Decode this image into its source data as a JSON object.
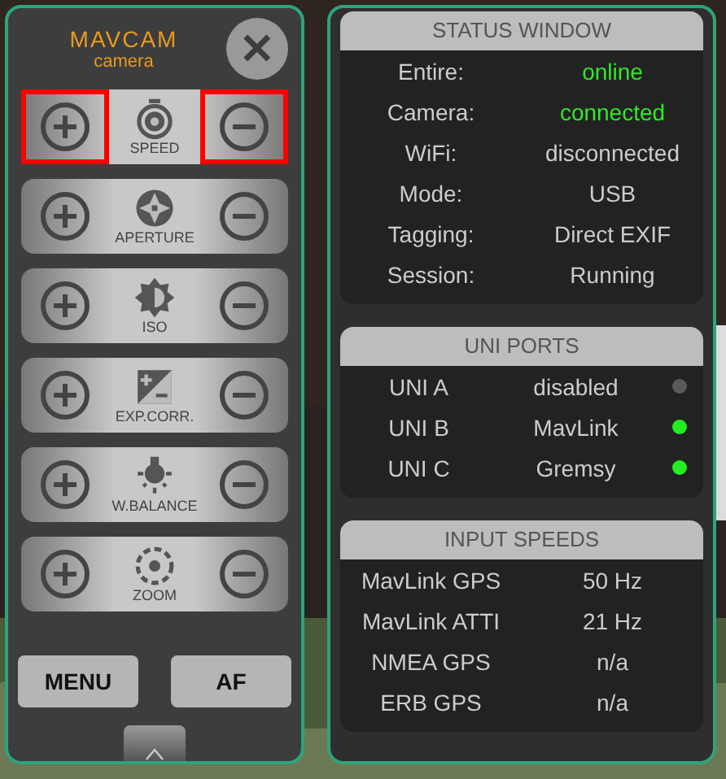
{
  "brand": {
    "title": "MAVCAM",
    "subtitle": "camera"
  },
  "close": {
    "label": "✕"
  },
  "controls": [
    {
      "label": "SPEED",
      "plus_highlighted": true,
      "minus_highlighted": true
    },
    {
      "label": "APERTURE",
      "plus_highlighted": false,
      "minus_highlighted": false
    },
    {
      "label": "ISO",
      "plus_highlighted": false,
      "minus_highlighted": false
    },
    {
      "label": "EXP.CORR.",
      "plus_highlighted": false,
      "minus_highlighted": false
    },
    {
      "label": "W.BALANCE",
      "plus_highlighted": false,
      "minus_highlighted": false
    },
    {
      "label": "ZOOM",
      "plus_highlighted": false,
      "minus_highlighted": false
    }
  ],
  "buttons": [
    "MENU",
    "AF"
  ],
  "status_window": {
    "title": "STATUS WINDOW",
    "rows": [
      {
        "label": "Entire:",
        "value": "online",
        "ok": true
      },
      {
        "label": "Camera:",
        "value": "connected",
        "ok": true
      },
      {
        "label": "WiFi:",
        "value": "disconnected",
        "ok": false
      },
      {
        "label": "Mode:",
        "value": "USB",
        "ok": false
      },
      {
        "label": "Tagging:",
        "value": "Direct EXIF",
        "ok": false
      },
      {
        "label": "Session:",
        "value": "Running",
        "ok": false
      }
    ]
  },
  "uni_ports": {
    "title": "UNI PORTS",
    "rows": [
      {
        "port": "UNI A",
        "protocol": "disabled",
        "active": false
      },
      {
        "port": "UNI B",
        "protocol": "MavLink",
        "active": true
      },
      {
        "port": "UNI C",
        "protocol": "Gremsy",
        "active": true
      }
    ]
  },
  "input_speeds": {
    "title": "INPUT SPEEDS",
    "rows": [
      {
        "source": "MavLink GPS",
        "rate": "50 Hz"
      },
      {
        "source": "MavLink ATTI",
        "rate": "21 Hz"
      },
      {
        "source": "NMEA GPS",
        "rate": "n/a"
      },
      {
        "source": "ERB GPS",
        "rate": "n/a"
      }
    ]
  }
}
